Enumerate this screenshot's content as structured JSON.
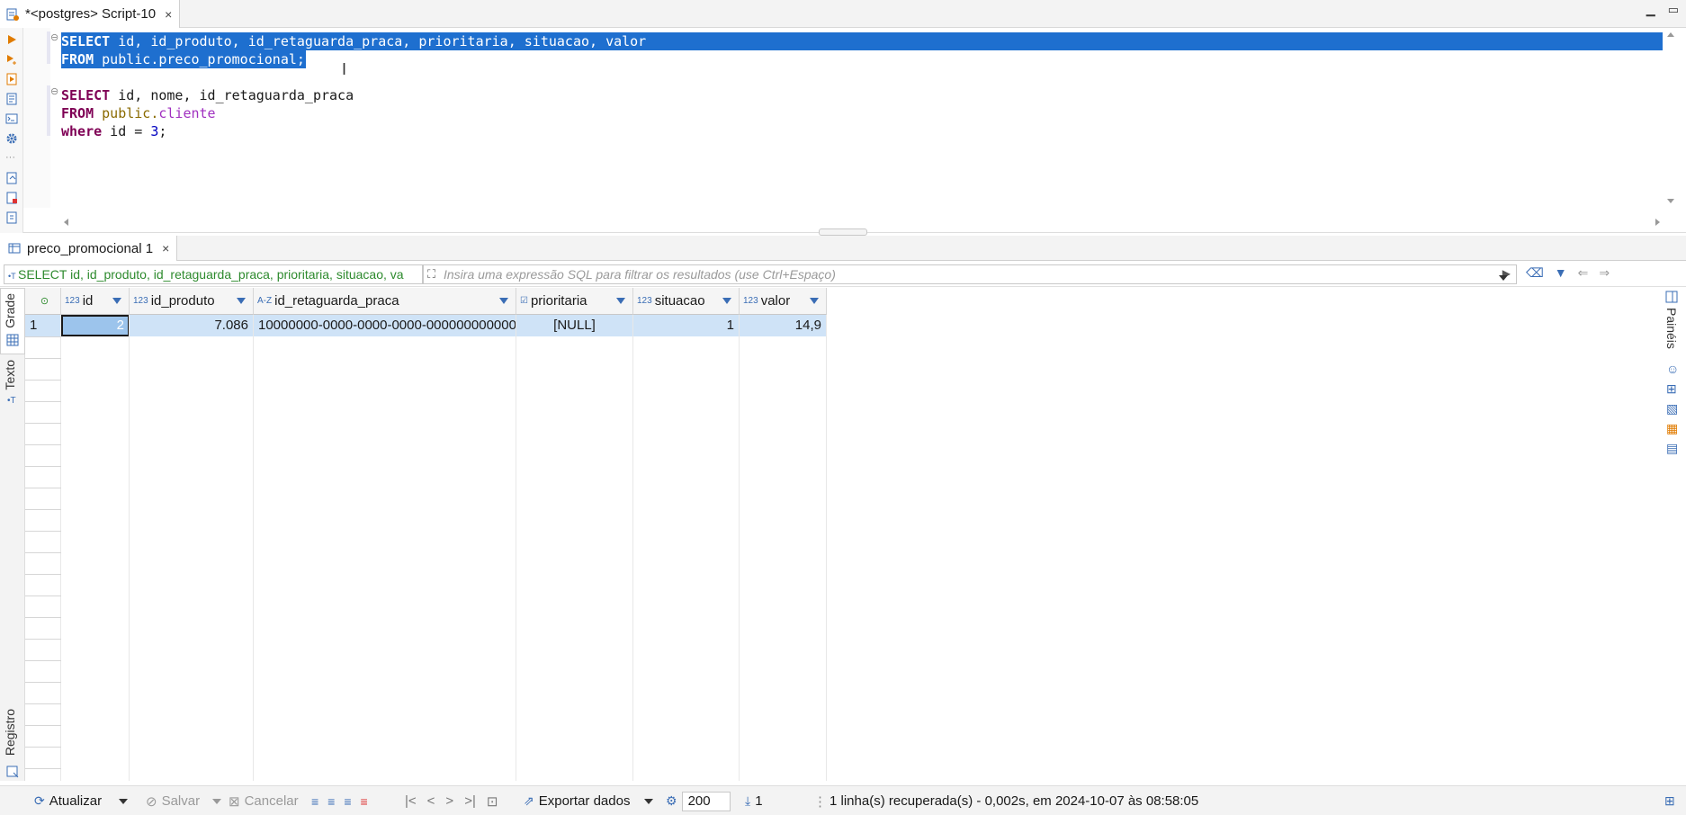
{
  "window": {
    "tab_title": "*<postgres> Script-10",
    "tab_close": "×",
    "minimize": "▁",
    "maximize": "▭"
  },
  "editor": {
    "lines": [
      {
        "selected": true,
        "tokens": [
          [
            "kw",
            "SELECT"
          ],
          [
            "id",
            " id, id_produto, id_retaguarda_praca, prioritaria, situacao, valor"
          ]
        ]
      },
      {
        "selected": true,
        "tokens": [
          [
            "kw",
            "FROM"
          ],
          [
            "id",
            " public.preco_promocional;"
          ]
        ]
      },
      {
        "selected": false,
        "tokens": []
      },
      {
        "selected": false,
        "tokens": [
          [
            "kw",
            "SELECT"
          ],
          [
            "id",
            " id, nome, id_retaguarda_praca"
          ]
        ]
      },
      {
        "selected": false,
        "tokens": [
          [
            "kw",
            "FROM"
          ],
          [
            "sch",
            " public."
          ],
          [
            "tbl",
            "cliente"
          ]
        ]
      },
      {
        "selected": false,
        "tokens": [
          [
            "kw2",
            "where"
          ],
          [
            "id",
            " id = "
          ],
          [
            "num",
            "3"
          ],
          [
            "id",
            ";"
          ]
        ]
      }
    ]
  },
  "results": {
    "tab_label": "preco_promocional 1",
    "tab_close": "×",
    "filter_query": "SELECT id, id_produto, id_retaguarda_praca, prioritaria, situacao, va",
    "filter_placeholder": "Insira uma expressão SQL para filtrar os resultados (use Ctrl+Espaço)",
    "side_tabs": {
      "grid": "Grade",
      "text": "Texto",
      "record": "Registro",
      "panels": "Painéis"
    },
    "columns": [
      {
        "type": "123",
        "name": "id"
      },
      {
        "type": "123",
        "name": "id_produto"
      },
      {
        "type": "A-Z",
        "name": "id_retaguarda_praca"
      },
      {
        "type": "☑",
        "name": "prioritaria"
      },
      {
        "type": "123",
        "name": "situacao"
      },
      {
        "type": "123",
        "name": "valor"
      }
    ],
    "rows": [
      {
        "num": "1",
        "cells": [
          "2",
          "7.086",
          "10000000-0000-0000-0000-000000000000",
          "[NULL]",
          "1",
          "14,9"
        ]
      }
    ]
  },
  "statusbar": {
    "refresh": "Atualizar",
    "save": "Salvar",
    "cancel": "Cancelar",
    "export": "Exportar dados",
    "limit": "200",
    "count": "1",
    "message": "1 linha(s) recuperada(s) - 0,002s, em 2024-10-07 às 08:58:05"
  }
}
